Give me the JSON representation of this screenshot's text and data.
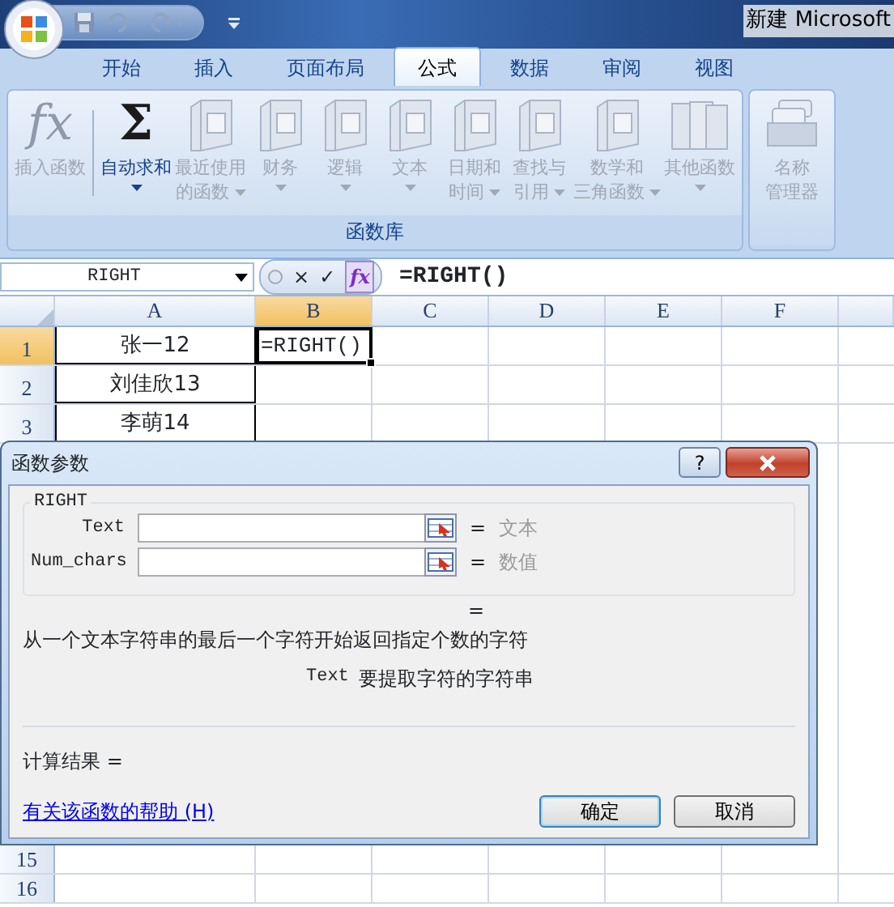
{
  "title_bar": {
    "title": "新建 Microsoft"
  },
  "ribbon_tabs": [
    {
      "label": "开始",
      "selected": false
    },
    {
      "label": "插入",
      "selected": false
    },
    {
      "label": "页面布局",
      "selected": false
    },
    {
      "label": "公式",
      "selected": true
    },
    {
      "label": "数据",
      "selected": false
    },
    {
      "label": "审阅",
      "selected": false
    },
    {
      "label": "视图",
      "selected": false
    }
  ],
  "ribbon_groups": [
    {
      "label": "函数库",
      "buttons": [
        {
          "kind": "glyph",
          "icon_text": "fx",
          "lines": [
            "插入函数"
          ],
          "disabled": true,
          "dropdown": false
        },
        {
          "kind": "glyph",
          "icon_text": "Σ",
          "lines": [
            "自动求和"
          ],
          "disabled": false,
          "dropdown": true
        },
        {
          "kind": "book",
          "lines": [
            "最近使用",
            "的函数"
          ],
          "disabled": true,
          "dropdown": true
        },
        {
          "kind": "book",
          "lines": [
            "财务"
          ],
          "disabled": true,
          "dropdown": true
        },
        {
          "kind": "book",
          "lines": [
            "逻辑"
          ],
          "disabled": true,
          "dropdown": true
        },
        {
          "kind": "book",
          "lines": [
            "文本"
          ],
          "disabled": true,
          "dropdown": true
        },
        {
          "kind": "book",
          "lines": [
            "日期和",
            "时间"
          ],
          "disabled": true,
          "dropdown": true
        },
        {
          "kind": "book",
          "lines": [
            "查找与",
            "引用"
          ],
          "disabled": true,
          "dropdown": true
        },
        {
          "kind": "book",
          "lines": [
            "数学和",
            "三角函数"
          ],
          "disabled": true,
          "dropdown": true
        },
        {
          "kind": "books",
          "lines": [
            "其他函数"
          ],
          "disabled": true,
          "dropdown": true
        }
      ]
    },
    {
      "buttons": [
        {
          "kind": "cards",
          "lines": [
            "名称",
            "管理器"
          ],
          "disabled": true,
          "dropdown": false
        }
      ]
    }
  ],
  "formula_bar": {
    "name_box": "RIGHT",
    "cancel": "×",
    "enter": "✓",
    "fx": "fx",
    "formula": "=RIGHT()"
  },
  "sheet": {
    "columns": [
      {
        "label": "A",
        "selected": false
      },
      {
        "label": "B",
        "selected": true
      },
      {
        "label": "C",
        "selected": false
      },
      {
        "label": "D",
        "selected": false
      },
      {
        "label": "E",
        "selected": false
      },
      {
        "label": "F",
        "selected": false
      }
    ],
    "rows": [
      {
        "label": "1",
        "selected": true,
        "cells": [
          {
            "text": "张一12",
            "bordered": true,
            "active": false
          },
          {
            "text": "=RIGHT()",
            "bordered": false,
            "active": true
          }
        ]
      },
      {
        "label": "2",
        "selected": false,
        "cells": [
          {
            "text": "刘佳欣13",
            "bordered": true,
            "active": false
          }
        ]
      },
      {
        "label": "3",
        "selected": false,
        "cells": [
          {
            "text": "李萌14",
            "bordered": true,
            "active": false
          }
        ]
      }
    ],
    "bottom_rows": [
      {
        "label": "15",
        "selected": false
      },
      {
        "label": "16",
        "selected": false
      }
    ]
  },
  "dialog": {
    "title": "函数参数",
    "help_button": "?",
    "function_name": "RIGHT",
    "arguments": [
      {
        "label": "Text",
        "equals": "=",
        "hint": "文本"
      },
      {
        "label": "Num_chars",
        "equals": "=",
        "hint": "数值"
      }
    ],
    "result_equals": "=",
    "description": "从一个文本字符串的最后一个字符开始返回指定个数的字符",
    "arg_name": "Text",
    "arg_description": "要提取字符的字符串",
    "result_label": "计算结果 =",
    "help_link": "有关该函数的帮助 (H)",
    "buttons": [
      {
        "label": "确定",
        "default": true
      },
      {
        "label": "取消",
        "default": false
      }
    ]
  }
}
